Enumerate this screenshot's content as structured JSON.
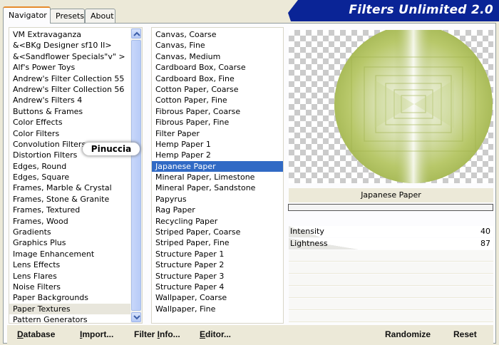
{
  "tabs": [
    "Navigator",
    "Presets",
    "About"
  ],
  "active_tab": "Navigator",
  "banner": {
    "title": "Filters Unlimited 2.0",
    "color": "#0a2496"
  },
  "categories": [
    "VM Extravaganza",
    "&<BKg Designer sf10 II>",
    "&<Sandflower Specials\"v\" >",
    "Alf's Power Toys",
    "Andrew's Filter Collection 55",
    "Andrew's Filter Collection 56",
    "Andrew's Filters 4",
    "Buttons & Frames",
    "Color Effects",
    "Color Filters",
    "Convolution Filters",
    "Distortion Filters",
    "Edges, Round",
    "Edges, Square",
    "Frames, Marble & Crystal",
    "Frames, Stone & Granite",
    "Frames, Textured",
    "Frames, Wood",
    "Gradients",
    "Graphics Plus",
    "Image Enhancement",
    "Lens Effects",
    "Lens Flares",
    "Noise Filters",
    "Paper Backgrounds",
    "Paper Textures",
    "Pattern Generators"
  ],
  "selected_category": "Paper Textures",
  "filters": [
    "Canvas, Coarse",
    "Canvas, Fine",
    "Canvas, Medium",
    "Cardboard Box, Coarse",
    "Cardboard Box, Fine",
    "Cotton Paper, Coarse",
    "Cotton Paper, Fine",
    "Fibrous Paper, Coarse",
    "Fibrous Paper, Fine",
    "Filter Paper",
    "Hemp Paper 1",
    "Hemp Paper 2",
    "Japanese Paper",
    "Mineral Paper, Limestone",
    "Mineral Paper, Sandstone",
    "Papyrus",
    "Rag Paper",
    "Recycling Paper",
    "Striped Paper, Coarse",
    "Striped Paper, Fine",
    "Structure Paper 1",
    "Structure Paper 2",
    "Structure Paper 3",
    "Structure Paper 4",
    "Wallpaper, Coarse",
    "Wallpaper, Fine"
  ],
  "selected_filter": "Japanese Paper",
  "watermark": "Pinuccia",
  "preview": {
    "filter_name": "Japanese Paper",
    "accent_color": "#a8ba4e",
    "progress": 0
  },
  "sliders": [
    {
      "label": "Intensity",
      "value": "40",
      "level": 40
    },
    {
      "label": "Lightness",
      "value": "87",
      "level": 87
    }
  ],
  "buttons": {
    "database": {
      "first": "D",
      "rest": "atabase"
    },
    "import": {
      "first": "I",
      "rest": "mport..."
    },
    "filter_info": {
      "prefix": "Filter ",
      "first": "I",
      "rest": "nfo..."
    },
    "editor": {
      "first": "E",
      "rest": "ditor..."
    },
    "randomize": "Randomize",
    "reset": "Reset"
  }
}
